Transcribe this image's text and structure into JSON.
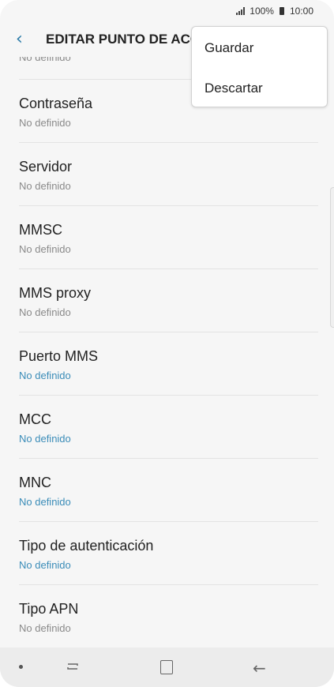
{
  "status": {
    "battery_percent": "100%",
    "time": "10:00"
  },
  "appbar": {
    "back_icon": "chevron-left-icon",
    "title": "EDITAR PUNTO DE ACCESO"
  },
  "list": {
    "partial_value": "No definido",
    "items": [
      {
        "label": "Contraseña",
        "value": "No definido"
      },
      {
        "label": "Servidor",
        "value": "No definido"
      },
      {
        "label": "MMSC",
        "value": "No definido"
      },
      {
        "label": "MMS proxy",
        "value": "No definido"
      },
      {
        "label": "Puerto MMS",
        "value": "No definido"
      },
      {
        "label": "MCC",
        "value": "No definido"
      },
      {
        "label": "MNC",
        "value": "No definido"
      },
      {
        "label": "Tipo de autenticación",
        "value": "No definido"
      },
      {
        "label": "Tipo APN",
        "value": "No definido"
      }
    ]
  },
  "menu": {
    "save_label": "Guardar",
    "discard_label": "Descartar"
  },
  "colors": {
    "accent": "#3a8cb8",
    "text_primary": "#222222",
    "text_secondary": "#8a8a8a"
  }
}
